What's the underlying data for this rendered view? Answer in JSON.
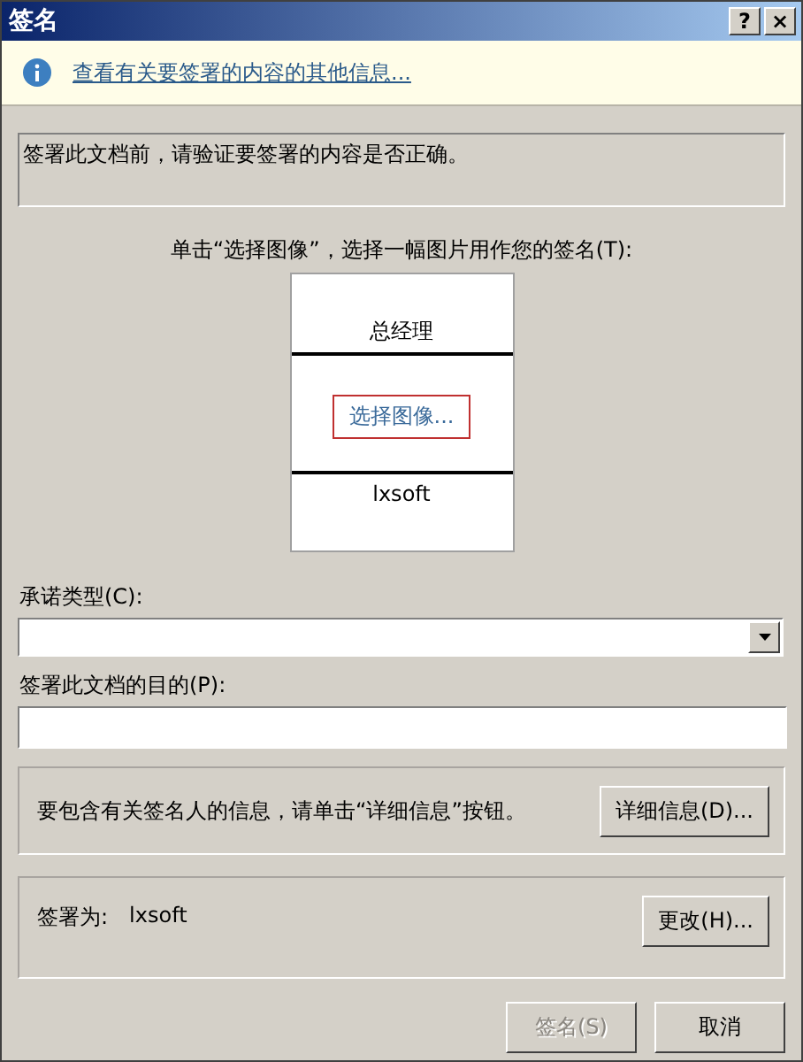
{
  "window": {
    "title": "签名",
    "help_button": "?",
    "close_button": "×"
  },
  "info_bar": {
    "link": "查看有关要签署的内容的其他信息..."
  },
  "notice": "签署此文档前，请验证要签署的内容是否正确。",
  "signature": {
    "caption": "单击“选择图像”，选择一幅图片用作您的签名(T):",
    "title": "总经理",
    "select_image": "选择图像...",
    "name": "lxsoft"
  },
  "commitment_type": {
    "label": "承诺类型(C):"
  },
  "purpose": {
    "label": "签署此文档的目的(P):"
  },
  "details": {
    "text": "要包含有关签名人的信息，请单击“详细信息”按钮。",
    "button": "详细信息(D)..."
  },
  "signer": {
    "label": "签署为:",
    "name": "lxsoft",
    "button": "更改(H)..."
  },
  "buttons": [
    {
      "label": "签名(S)",
      "disabled": true
    },
    {
      "label": "取消",
      "disabled": false
    }
  ]
}
